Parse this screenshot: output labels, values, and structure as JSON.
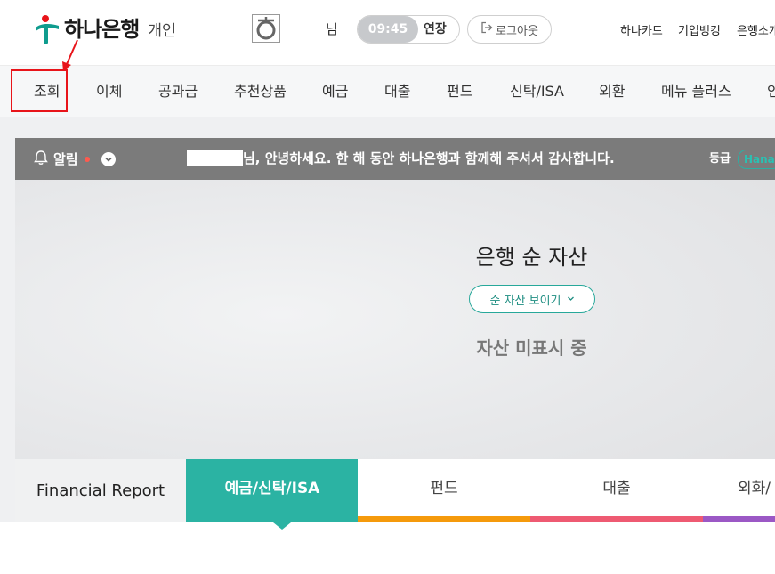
{
  "header": {
    "logo_name": "하나은행",
    "logo_sub": "개인",
    "user_suffix": "님",
    "timer": "09:45",
    "extend_label": "연장",
    "logout_label": "로그아웃",
    "util_links": [
      "하나카드",
      "기업뱅킹",
      "은행소개"
    ]
  },
  "gnb": {
    "items": [
      "조회",
      "이체",
      "공과금",
      "추천상품",
      "예금",
      "대출",
      "펀드",
      "신탁/ISA",
      "외환",
      "메뉴 플러스",
      "인"
    ]
  },
  "notice": {
    "alarm_label": "알림",
    "greeting": "님, 안녕하세요. 한 해 동안 하나은행과 함께해 주셔서 감사합니다.",
    "grade_label": "등급",
    "grade_badge": "Hana"
  },
  "assets": {
    "title": "은행 순 자산",
    "toggle_label": "순 자산 보이기",
    "status": "자산 미표시 중"
  },
  "tabs": {
    "report": "Financial Report",
    "items": [
      {
        "label": "예금/신탁/ISA",
        "color": "#2bb3a3"
      },
      {
        "label": "펀드",
        "color": "#f59a0c"
      },
      {
        "label": "대출",
        "color": "#ee5a72"
      },
      {
        "label": "외화/",
        "color": "#9b58c5"
      }
    ]
  },
  "colors": {
    "brand_teal": "#2bb3a3",
    "brand_red": "#e8141a",
    "highlight": "#e8141a"
  }
}
